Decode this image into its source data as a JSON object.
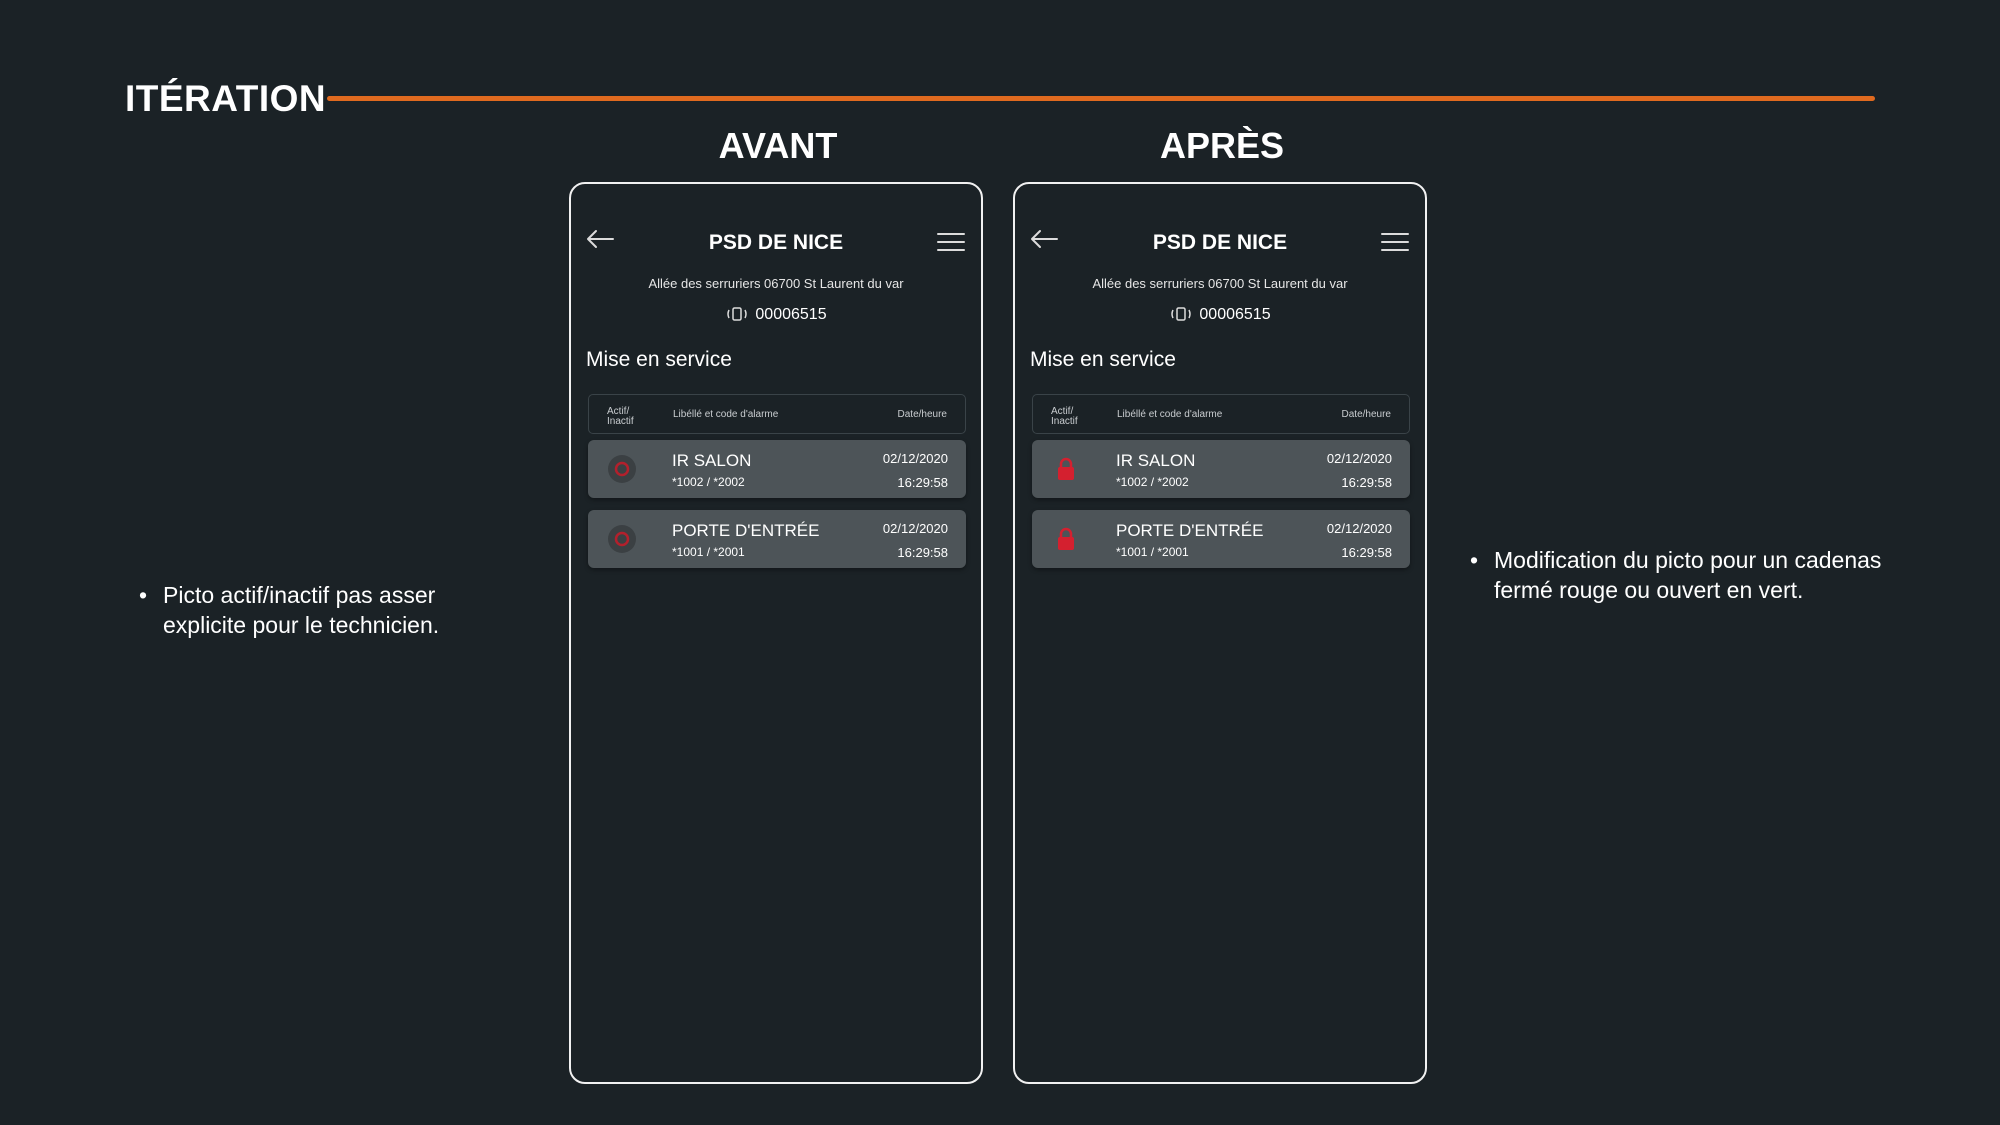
{
  "slide": {
    "title": "ITÉRATION",
    "accent_color": "#e06a1f",
    "before_label": "AVANT",
    "after_label": "APRÈS"
  },
  "screen": {
    "title": "PSD DE NICE",
    "address": "Allée des serruriers 06700 St Laurent du var",
    "device_code": "00006515",
    "section": "Mise en service",
    "table_headers": {
      "status": "Actif/\nInactif",
      "label": "Libéllé et code d'alarme",
      "datetime": "Date/heure"
    },
    "alarms": [
      {
        "name": "IR SALON",
        "codes": "*1002 / *2002",
        "date": "02/12/2020",
        "time": "16:29:58"
      },
      {
        "name": "PORTE D'ENTRÉE",
        "codes": "*1001 / *2001",
        "date": "02/12/2020",
        "time": "16:29:58"
      }
    ]
  },
  "icons": {
    "back": "arrow-left-icon",
    "menu": "hamburger-menu-icon",
    "device": "vibrating-device-icon",
    "status_before": "power-dot-icon",
    "status_after": "lock-closed-icon",
    "status_color": "#d4202f"
  },
  "notes": {
    "before": "Picto actif/inactif pas asser explicite pour le technicien.",
    "after": "Modification du picto pour un cadenas fermé rouge ou ouvert en vert."
  }
}
